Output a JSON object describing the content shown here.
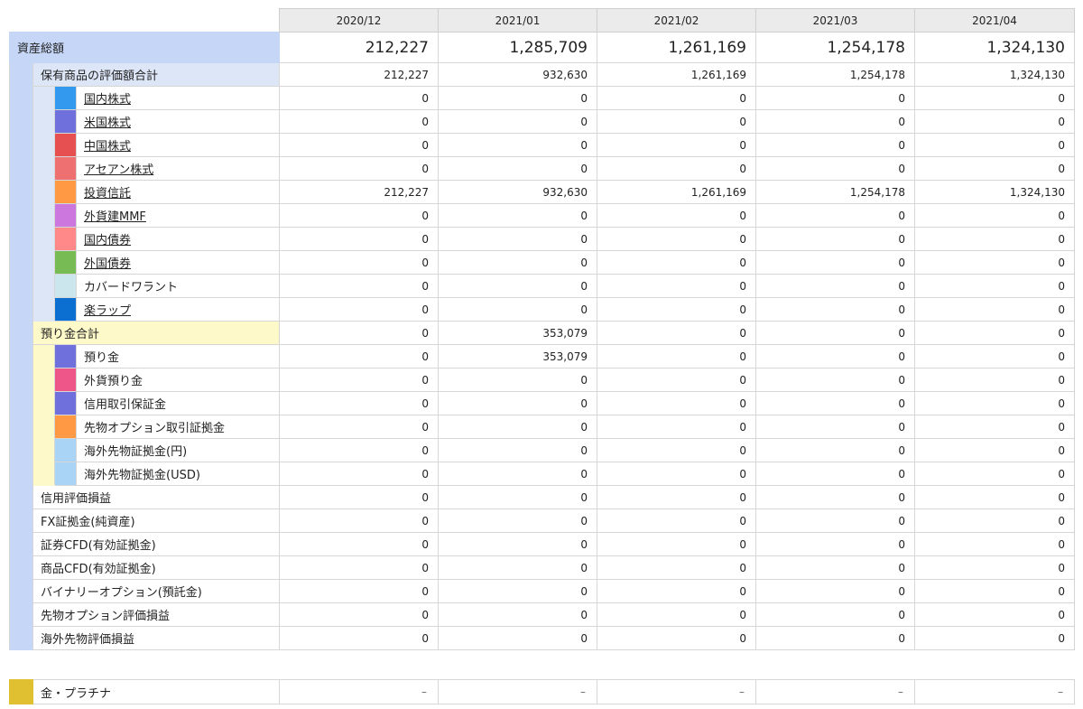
{
  "periods": [
    "2020/12",
    "2021/01",
    "2021/02",
    "2021/03",
    "2021/04"
  ],
  "total": {
    "label": "資産総額",
    "values": [
      "212,227",
      "1,285,709",
      "1,261,169",
      "1,254,178",
      "1,324,130"
    ]
  },
  "holdings": {
    "label": "保有商品の評価額合計",
    "values": [
      "212,227",
      "932,630",
      "1,261,169",
      "1,254,178",
      "1,324,130"
    ],
    "items": [
      {
        "label": "国内株式",
        "color": "#3399ee",
        "link": true,
        "values": [
          "0",
          "0",
          "0",
          "0",
          "0"
        ]
      },
      {
        "label": "米国株式",
        "color": "#7070dd",
        "link": true,
        "values": [
          "0",
          "0",
          "0",
          "0",
          "0"
        ]
      },
      {
        "label": "中国株式",
        "color": "#e65050",
        "link": true,
        "values": [
          "0",
          "0",
          "0",
          "0",
          "0"
        ]
      },
      {
        "label": "アセアン株式",
        "color": "#ee7070",
        "link": true,
        "values": [
          "0",
          "0",
          "0",
          "0",
          "0"
        ]
      },
      {
        "label": "投資信託",
        "color": "#ff9944",
        "link": true,
        "values": [
          "212,227",
          "932,630",
          "1,261,169",
          "1,254,178",
          "1,324,130"
        ]
      },
      {
        "label": "外貨建MMF",
        "color": "#cc77dd",
        "link": true,
        "values": [
          "0",
          "0",
          "0",
          "0",
          "0"
        ]
      },
      {
        "label": "国内債券",
        "color": "#ff8888",
        "link": true,
        "values": [
          "0",
          "0",
          "0",
          "0",
          "0"
        ]
      },
      {
        "label": "外国債券",
        "color": "#77bb55",
        "link": true,
        "values": [
          "0",
          "0",
          "0",
          "0",
          "0"
        ]
      },
      {
        "label": "カバードワラント",
        "color": "#cce6ee",
        "link": false,
        "values": [
          "0",
          "0",
          "0",
          "0",
          "0"
        ]
      },
      {
        "label": "楽ラップ",
        "color": "#0a6fd0",
        "link": true,
        "values": [
          "0",
          "0",
          "0",
          "0",
          "0"
        ]
      }
    ]
  },
  "deposits": {
    "label": "預り金合計",
    "values": [
      "0",
      "353,079",
      "0",
      "0",
      "0"
    ],
    "items": [
      {
        "label": "預り金",
        "color": "#7070dd",
        "values": [
          "0",
          "353,079",
          "0",
          "0",
          "0"
        ]
      },
      {
        "label": "外貨預り金",
        "color": "#ee5588",
        "values": [
          "0",
          "0",
          "0",
          "0",
          "0"
        ]
      },
      {
        "label": "信用取引保証金",
        "color": "#7070dd",
        "values": [
          "0",
          "0",
          "0",
          "0",
          "0"
        ]
      },
      {
        "label": "先物オプション取引証拠金",
        "color": "#ff9944",
        "values": [
          "0",
          "0",
          "0",
          "0",
          "0"
        ]
      },
      {
        "label": "海外先物証拠金(円)",
        "color": "#aad4f5",
        "values": [
          "0",
          "0",
          "0",
          "0",
          "0"
        ]
      },
      {
        "label": "海外先物証拠金(USD)",
        "color": "#aad4f5",
        "values": [
          "0",
          "0",
          "0",
          "0",
          "0"
        ]
      }
    ]
  },
  "others": [
    {
      "label": "信用評価損益",
      "values": [
        "0",
        "0",
        "0",
        "0",
        "0"
      ]
    },
    {
      "label": "FX証拠金(純資産)",
      "values": [
        "0",
        "0",
        "0",
        "0",
        "0"
      ]
    },
    {
      "label": "証券CFD(有効証拠金)",
      "values": [
        "0",
        "0",
        "0",
        "0",
        "0"
      ]
    },
    {
      "label": "商品CFD(有効証拠金)",
      "values": [
        "0",
        "0",
        "0",
        "0",
        "0"
      ]
    },
    {
      "label": "バイナリーオプション(預託金)",
      "values": [
        "0",
        "0",
        "0",
        "0",
        "0"
      ]
    },
    {
      "label": "先物オプション評価損益",
      "values": [
        "0",
        "0",
        "0",
        "0",
        "0"
      ]
    },
    {
      "label": "海外先物評価損益",
      "values": [
        "0",
        "0",
        "0",
        "0",
        "0"
      ]
    }
  ],
  "gold": {
    "label": "金・プラチナ",
    "color": "#e0c030",
    "values": [
      "–",
      "–",
      "–",
      "–",
      "–"
    ]
  }
}
